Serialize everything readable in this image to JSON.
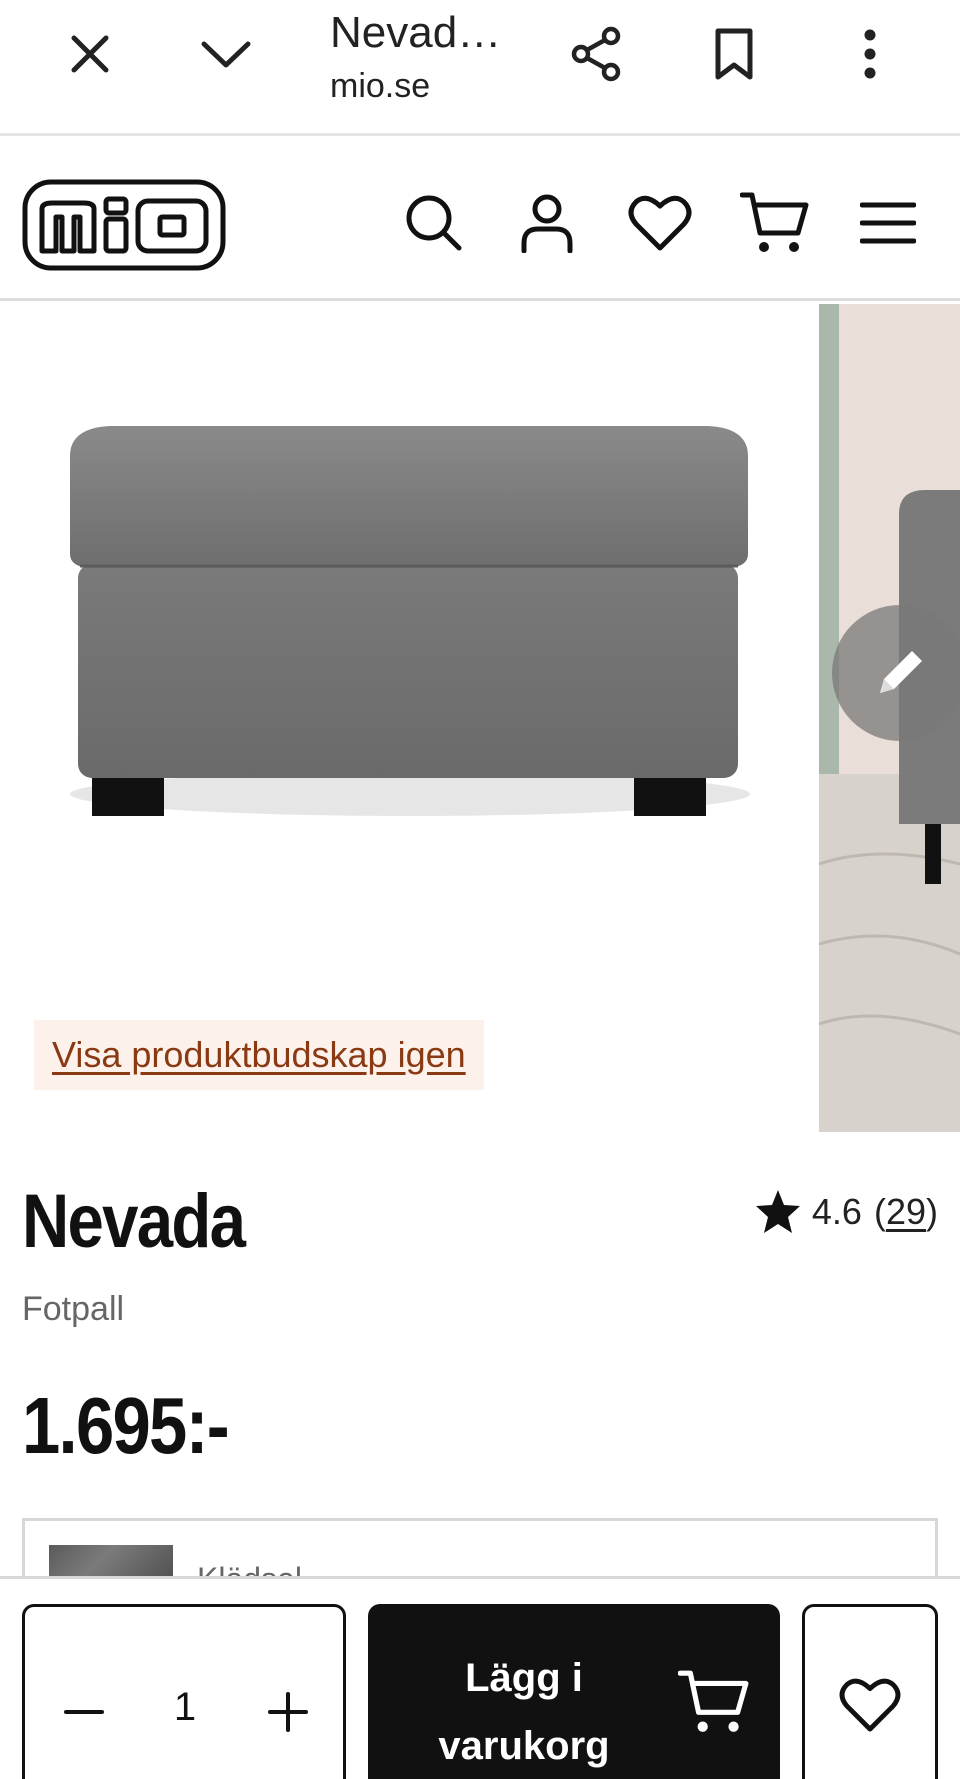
{
  "browser": {
    "title": "Nevad…",
    "domain": "mio.se",
    "icons": [
      "close-icon",
      "chevron-down-icon",
      "share-icon",
      "bookmark-icon",
      "more-vert-icon"
    ]
  },
  "header": {
    "logo_text": "mio",
    "icons": [
      "search-icon",
      "account-icon",
      "heart-icon",
      "cart-icon",
      "menu-icon"
    ]
  },
  "gallery": {
    "show_message_link": "Visa produktbudskap igen"
  },
  "product": {
    "name": "Nevada",
    "subtitle": "Fotpall",
    "rating": "4.6",
    "review_open": "(",
    "review_count": "29",
    "review_close": ")",
    "price": "1.695:-"
  },
  "variant": {
    "label": "Klädsel"
  },
  "bottom_bar": {
    "quantity": "1",
    "add_to_cart_line1": "Lägg i",
    "add_to_cart_line2": "varukorg"
  },
  "colors": {
    "accent_link": "#8a3a12",
    "link_bg": "#fdf1ec",
    "primary_button": "#111111"
  }
}
